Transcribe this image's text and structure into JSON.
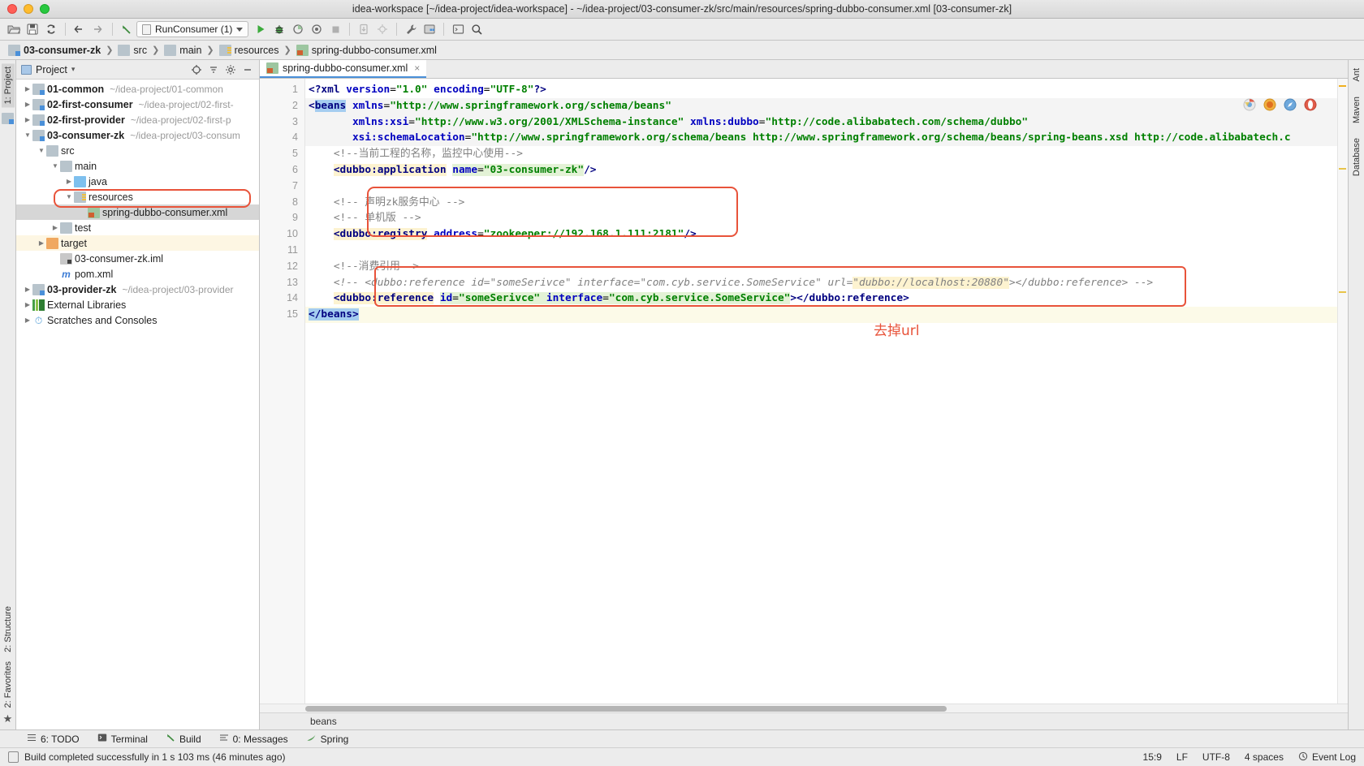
{
  "window": {
    "title": "idea-workspace [~/idea-project/idea-workspace] - ~/idea-project/03-consumer-zk/src/main/resources/spring-dubbo-consumer.xml [03-consumer-zk]"
  },
  "toolbar": {
    "run_config_label": "RunConsumer (1)",
    "buttons": [
      {
        "name": "open-project-icon",
        "glyph": "▰"
      },
      {
        "name": "save-all-icon",
        "glyph": "▣"
      },
      {
        "name": "sync-icon",
        "glyph": "↻"
      },
      {
        "name": "back-icon",
        "glyph": "←"
      },
      {
        "name": "forward-icon",
        "glyph": "→"
      },
      {
        "name": "last-edit-location-icon",
        "glyph": "↖"
      },
      {
        "name": "run-icon",
        "glyph": "▶"
      },
      {
        "name": "debug-icon",
        "glyph": "⚙"
      },
      {
        "name": "run-coverage-icon",
        "glyph": "◔"
      },
      {
        "name": "profile-icon",
        "glyph": "◕"
      },
      {
        "name": "stop-icon",
        "glyph": "■"
      },
      {
        "name": "update-app-icon",
        "glyph": "⬇"
      },
      {
        "name": "attach-icon",
        "glyph": "⌖"
      },
      {
        "name": "settings-wrench-icon",
        "glyph": "ὒ7"
      },
      {
        "name": "project-structure-icon",
        "glyph": "▤"
      },
      {
        "name": "terminal-icon",
        "glyph": "▭"
      },
      {
        "name": "search-everywhere-icon",
        "glyph": "⌕"
      }
    ]
  },
  "breadcrumb": {
    "items": [
      {
        "label": "03-consumer-zk",
        "icon": "module-icon",
        "bold": true
      },
      {
        "label": "src",
        "icon": "folder-icon",
        "bold": false
      },
      {
        "label": "main",
        "icon": "folder-icon",
        "bold": false
      },
      {
        "label": "resources",
        "icon": "resources-folder-icon",
        "bold": false
      },
      {
        "label": "spring-dubbo-consumer.xml",
        "icon": "xml-file-icon",
        "bold": false
      }
    ],
    "separator": "❯"
  },
  "left_strip": {
    "top_tab": "1: Project",
    "bottom_tabs": [
      "2: Structure",
      "2: Favorites"
    ]
  },
  "right_strip": {
    "tabs": [
      "Ant",
      "Maven",
      "Database"
    ]
  },
  "project_panel": {
    "title": "Project",
    "caret": "▾",
    "header_buttons": [
      {
        "name": "locate-icon",
        "glyph": "⊕"
      },
      {
        "name": "collapse-all-icon",
        "glyph": "≡"
      },
      {
        "name": "gear-icon",
        "glyph": "⚙"
      },
      {
        "name": "hide-icon",
        "glyph": "−"
      }
    ],
    "tree": [
      {
        "name": "01-common",
        "path": "~/idea-project/01-common",
        "depth": 0,
        "arrow": "collapsed",
        "icon": "module-icon",
        "bold": true,
        "selected": false,
        "highlight": false
      },
      {
        "name": "02-first-consumer",
        "path": "~/idea-project/02-first-",
        "depth": 0,
        "arrow": "collapsed",
        "icon": "module-icon",
        "bold": true,
        "selected": false,
        "highlight": false
      },
      {
        "name": "02-first-provider",
        "path": "~/idea-project/02-first-p",
        "depth": 0,
        "arrow": "collapsed",
        "icon": "module-icon",
        "bold": true,
        "selected": false,
        "highlight": false
      },
      {
        "name": "03-consumer-zk",
        "path": "~/idea-project/03-consum",
        "depth": 0,
        "arrow": "expanded",
        "icon": "module-icon",
        "bold": true,
        "selected": false,
        "highlight": false
      },
      {
        "name": "src",
        "path": "",
        "depth": 1,
        "arrow": "expanded",
        "icon": "folder-icon",
        "bold": false,
        "selected": false,
        "highlight": false
      },
      {
        "name": "main",
        "path": "",
        "depth": 2,
        "arrow": "expanded",
        "icon": "folder-icon",
        "bold": false,
        "selected": false,
        "highlight": false
      },
      {
        "name": "java",
        "path": "",
        "depth": 3,
        "arrow": "collapsed",
        "icon": "sources-folder-icon",
        "bold": false,
        "selected": false,
        "highlight": false
      },
      {
        "name": "resources",
        "path": "",
        "depth": 3,
        "arrow": "expanded",
        "icon": "resources-folder-icon",
        "bold": false,
        "selected": false,
        "highlight": false
      },
      {
        "name": "spring-dubbo-consumer.xml",
        "path": "",
        "depth": 4,
        "arrow": "none",
        "icon": "xml-file-icon",
        "bold": false,
        "selected": true,
        "highlight": true
      },
      {
        "name": "test",
        "path": "",
        "depth": 2,
        "arrow": "collapsed",
        "icon": "folder-icon",
        "bold": false,
        "selected": false,
        "highlight": false
      },
      {
        "name": "target",
        "path": "",
        "depth": 1,
        "arrow": "collapsed",
        "icon": "excluded-folder-icon",
        "bold": false,
        "selected": false,
        "highlight": false,
        "rowHighlight": true
      },
      {
        "name": "03-consumer-zk.iml",
        "path": "",
        "depth": 2,
        "arrow": "none",
        "icon": "iml-file-icon",
        "bold": false,
        "selected": false,
        "highlight": false
      },
      {
        "name": "pom.xml",
        "path": "",
        "depth": 2,
        "arrow": "none",
        "icon": "maven-file-icon",
        "bold": false,
        "selected": false,
        "highlight": false
      },
      {
        "name": "03-provider-zk",
        "path": "~/idea-project/03-provider",
        "depth": 0,
        "arrow": "collapsed",
        "icon": "module-icon",
        "bold": true,
        "selected": false,
        "highlight": false
      },
      {
        "name": "External Libraries",
        "path": "",
        "depth": 0,
        "arrow": "collapsed",
        "icon": "libraries-icon",
        "bold": false,
        "selected": false,
        "highlight": false
      },
      {
        "name": "Scratches and Consoles",
        "path": "",
        "depth": 0,
        "arrow": "collapsed",
        "icon": "scratches-icon",
        "bold": false,
        "selected": false,
        "highlight": false
      }
    ]
  },
  "editor": {
    "tab_label": "spring-dubbo-consumer.xml",
    "tab_close": "×",
    "line_numbers": [
      "1",
      "2",
      "3",
      "4",
      "5",
      "6",
      "7",
      "8",
      "9",
      "10",
      "11",
      "12",
      "13",
      "14",
      "15"
    ],
    "lines": [
      {
        "n": 1,
        "text": "<?xml version=\"1.0\" encoding=\"UTF-8\"?>"
      },
      {
        "n": 2,
        "text": "<beans xmlns=\"http://www.springframework.org/schema/beans\""
      },
      {
        "n": 3,
        "text": "       xmlns:xsi=\"http://www.w3.org/2001/XMLSchema-instance\" xmlns:dubbo=\"http://code.alibabatech.com/schema/dubbo\""
      },
      {
        "n": 4,
        "text": "       xsi:schemaLocation=\"http://www.springframework.org/schema/beans http://www.springframework.org/schema/beans/spring-beans.xsd http://code.alibabatech.c"
      },
      {
        "n": 5,
        "text": "    <!--当前工程的名称，监控中心使用-->"
      },
      {
        "n": 6,
        "text": "    <dubbo:application name=\"03-consumer-zk\"/>"
      },
      {
        "n": 7,
        "text": ""
      },
      {
        "n": 8,
        "text": "    <!-- 声明zk服务中心 -->"
      },
      {
        "n": 9,
        "text": "    <!-- 单机版 -->"
      },
      {
        "n": 10,
        "text": "    <dubbo:registry address=\"zookeeper://192.168.1.111:2181\"/>"
      },
      {
        "n": 11,
        "text": ""
      },
      {
        "n": 12,
        "text": "    <!--消费引用-->"
      },
      {
        "n": 13,
        "text": "    <!-- <dubbo:reference id=\"someSerivce\" interface=\"com.cyb.service.SomeService\" url=\"dubbo://localhost:20880\"></dubbo:reference> -->"
      },
      {
        "n": 14,
        "text": "    <dubbo:reference id=\"someSerivce\" interface=\"com.cyb.service.SomeService\"></dubbo:reference>"
      },
      {
        "n": 15,
        "text": "</beans>"
      }
    ],
    "annotation": "去掉url",
    "bottom_breadcrumb": "beans"
  },
  "tool_windows": {
    "items": [
      {
        "label": "6: TODO",
        "mnemonic": "6",
        "icon": "todo-icon"
      },
      {
        "label": "Terminal",
        "mnemonic": "",
        "icon": "terminal-icon"
      },
      {
        "label": "Build",
        "mnemonic": "",
        "icon": "build-icon"
      },
      {
        "label": "0: Messages",
        "mnemonic": "0",
        "icon": "messages-icon"
      },
      {
        "label": "Spring",
        "mnemonic": "",
        "icon": "spring-icon"
      }
    ]
  },
  "status_bar": {
    "message": "Build completed successfully in 1 s 103 ms (46 minutes ago)",
    "caret_position": "15:9",
    "line_separator": "LF",
    "encoding": "UTF-8",
    "indent": "4 spaces",
    "event_log": "Event Log"
  },
  "colors": {
    "annotation": "#e8533a",
    "highlight_box": "#e8533a",
    "tab_underline": "#4a90d9",
    "selection": "#a5cdf0"
  }
}
